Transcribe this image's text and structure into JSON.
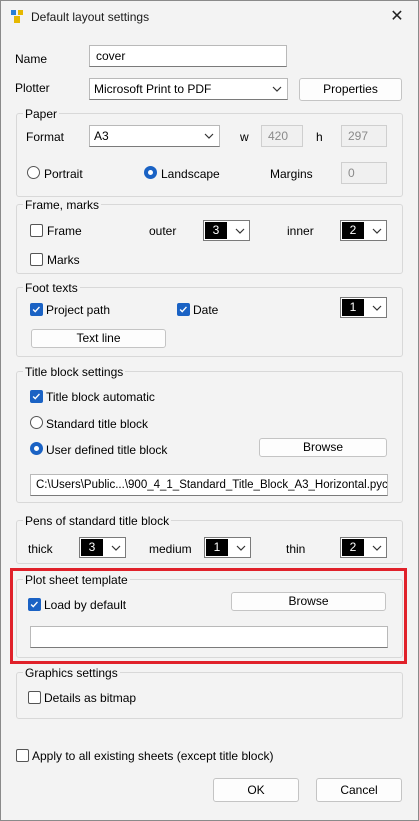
{
  "window": {
    "title": "Default layout settings",
    "close_glyph": "✕"
  },
  "name": {
    "label": "Name",
    "value": "cover"
  },
  "plotter": {
    "label": "Plotter",
    "value": "Microsoft Print to PDF",
    "properties_button": "Properties"
  },
  "paper": {
    "title": "Paper",
    "format_label": "Format",
    "format_value": "A3",
    "w_label": "w",
    "w_value": "420",
    "h_label": "h",
    "h_value": "297",
    "portrait_label": "Portrait",
    "landscape_label": "Landscape",
    "margins_label": "Margins",
    "margins_value": "0"
  },
  "frame_marks": {
    "title": "Frame, marks",
    "frame_label": "Frame",
    "outer_label": "outer",
    "outer_value": "3",
    "inner_label": "inner",
    "inner_value": "2",
    "marks_label": "Marks"
  },
  "foot_texts": {
    "title": "Foot texts",
    "project_path_label": "Project path",
    "date_label": "Date",
    "pen_value": "1",
    "text_line_button": "Text line"
  },
  "title_block": {
    "title": "Title block settings",
    "automatic_label": "Title block automatic",
    "standard_label": "Standard title block",
    "user_defined_label": "User defined title block",
    "browse_button": "Browse",
    "path_value": "C:\\Users\\Public...\\900_4_1_Standard_Title_Block_A3_Horizontal.pyc"
  },
  "pens_standard": {
    "title": "Pens of standard title block",
    "thick_label": "thick",
    "thick_value": "3",
    "medium_label": "medium",
    "medium_value": "1",
    "thin_label": "thin",
    "thin_value": "2"
  },
  "plot_sheet_template": {
    "title": "Plot sheet template",
    "load_default_label": "Load by default",
    "browse_button": "Browse",
    "path_value": ""
  },
  "graphics": {
    "title": "Graphics settings",
    "bitmap_label": "Details as bitmap"
  },
  "apply_all_label": "Apply to all existing sheets (except title block)",
  "buttons": {
    "ok": "OK",
    "cancel": "Cancel"
  },
  "colors": {
    "accent": "#1a62c4",
    "highlight": "#e0212a"
  }
}
